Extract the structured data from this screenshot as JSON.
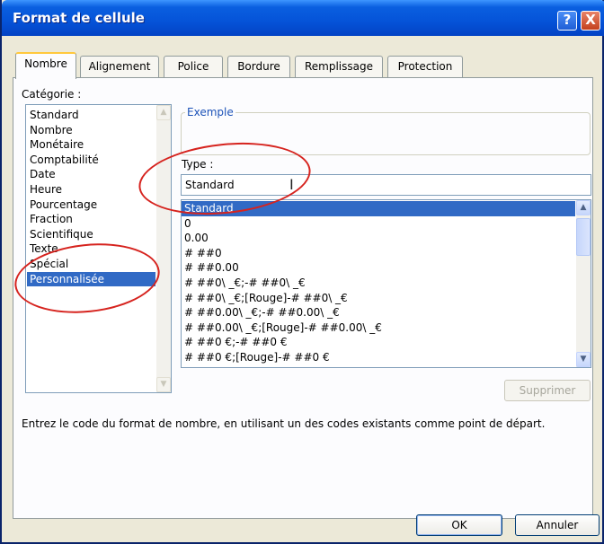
{
  "window": {
    "title": "Format de cellule",
    "help_button": "?",
    "close_button": "X"
  },
  "tabs": [
    {
      "label": "Nombre",
      "active": true
    },
    {
      "label": "Alignement",
      "active": false
    },
    {
      "label": "Police",
      "active": false
    },
    {
      "label": "Bordure",
      "active": false
    },
    {
      "label": "Remplissage",
      "active": false
    },
    {
      "label": "Protection",
      "active": false
    }
  ],
  "category": {
    "label": "Catégorie :",
    "items": [
      "Standard",
      "Nombre",
      "Monétaire",
      "Comptabilité",
      "Date",
      "Heure",
      "Pourcentage",
      "Fraction",
      "Scientifique",
      "Texte",
      "Spécial",
      "Personnalisée"
    ],
    "selected": "Personnalisée"
  },
  "example": {
    "label": "Exemple"
  },
  "type": {
    "label": "Type :",
    "value": "Standard",
    "formats": [
      "Standard",
      "0",
      "0.00",
      "# ##0",
      "# ##0.00",
      "# ##0\\ _€;-# ##0\\ _€",
      "# ##0\\ _€;[Rouge]-# ##0\\ _€",
      "# ##0.00\\ _€;-# ##0.00\\ _€",
      "# ##0.00\\ _€;[Rouge]-# ##0.00\\ _€",
      "# ##0 €;-# ##0 €",
      "# ##0 €;[Rouge]-# ##0 €"
    ],
    "selected": "Standard"
  },
  "buttons": {
    "delete": "Supprimer",
    "ok": "OK",
    "cancel": "Annuler"
  },
  "description": "Entrez le code du format de nombre, en utilisant un des codes existants comme point de départ.",
  "colors": {
    "titlebar": "#0553d8",
    "selection": "#316ac5",
    "annotation": "#d6231e",
    "dialog_bg": "#ece9d8"
  }
}
